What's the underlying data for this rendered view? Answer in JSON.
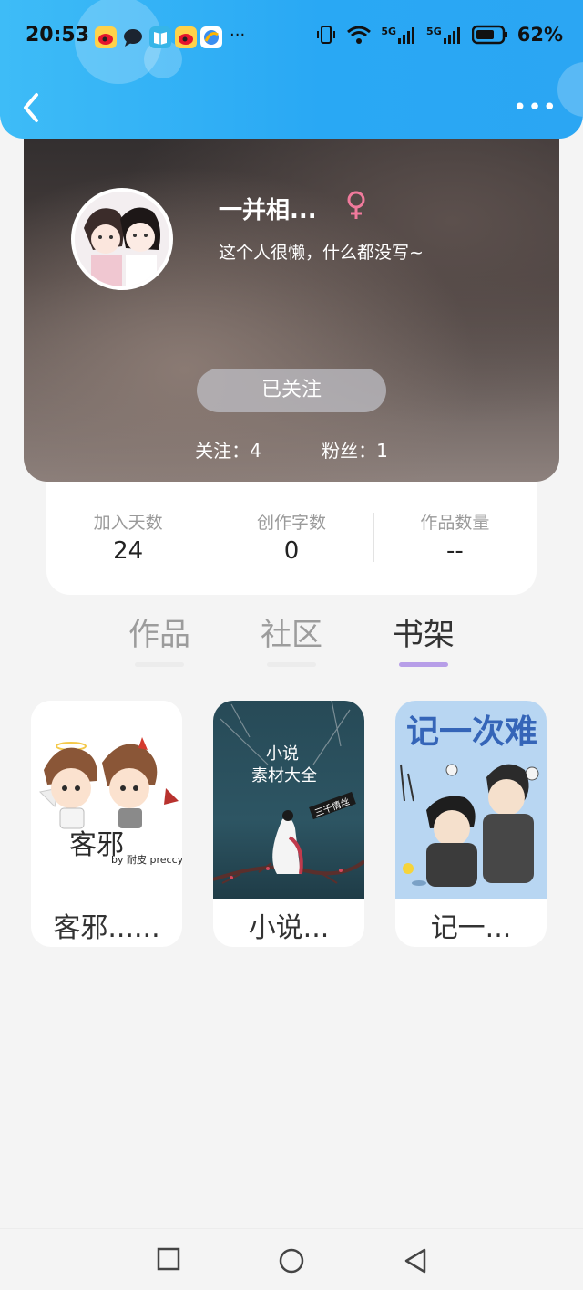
{
  "status_bar": {
    "time": "20:53",
    "battery": "62%",
    "network_1": "5G",
    "network_2": "5G",
    "overflow": "···",
    "icons": [
      "weibo-icon",
      "chat-bubble-icon",
      "reader-icon",
      "weibo-icon",
      "browser-icon"
    ]
  },
  "header": {
    "back_icon": "chevron-left-icon",
    "more_icon": "more-dots-icon",
    "more_label": "•••"
  },
  "profile": {
    "username": "一并相...",
    "gender_icon": "female-symbol-icon",
    "bio": "这个人很懒，什么都没写~",
    "follow_button": "已关注",
    "following": "关注：4",
    "followers": "粉丝：1"
  },
  "stats": [
    {
      "label": "加入天数",
      "value": "24"
    },
    {
      "label": "创作字数",
      "value": "0"
    },
    {
      "label": "作品数量",
      "value": "--"
    }
  ],
  "tabs": [
    {
      "label": "作品",
      "active": false
    },
    {
      "label": "社区",
      "active": false
    },
    {
      "label": "书架",
      "active": true
    }
  ],
  "bookshelf": [
    {
      "title": "客邪......",
      "cover_text": "客邪",
      "cover_sub": "by 耐皮 preccy"
    },
    {
      "title": "小说...",
      "cover_text_1": "小说",
      "cover_text_2": "素材大全",
      "cover_tag": "三千情丝"
    },
    {
      "title": "记一...",
      "cover_text": "记一次难"
    }
  ],
  "colors": {
    "header_gradient_start": "#3ebcf7",
    "header_gradient_end": "#2ba6f3",
    "tab_active_underline": "#b79ee8",
    "gender_pink": "#f07a9c"
  }
}
